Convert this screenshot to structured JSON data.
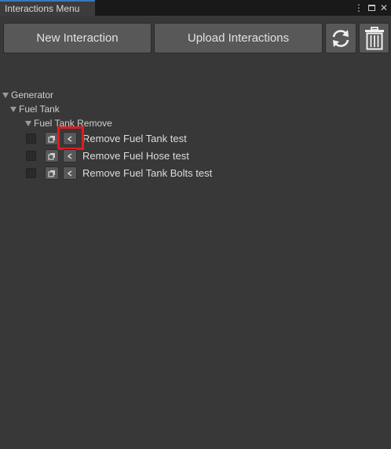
{
  "window": {
    "tab_title": "Interactions Menu",
    "menu_icon": "⋮",
    "close_icon": "✕"
  },
  "toolbar": {
    "new_label": "New Interaction",
    "upload_label": "Upload Interactions",
    "refresh_icon": "refresh-icon",
    "trash_icon": "trash-icon"
  },
  "tree": {
    "root": "Generator",
    "child": "Fuel Tank",
    "group": "Fuel Tank Remove",
    "items": [
      {
        "label": "Remove Fuel Tank test",
        "highlighted": true
      },
      {
        "label": "Remove Fuel Hose test",
        "highlighted": false
      },
      {
        "label": "Remove Fuel Tank Bolts test",
        "highlighted": false
      }
    ]
  },
  "colors": {
    "highlight": "#e01b24",
    "active_tab_accent": "#3a79bb"
  }
}
